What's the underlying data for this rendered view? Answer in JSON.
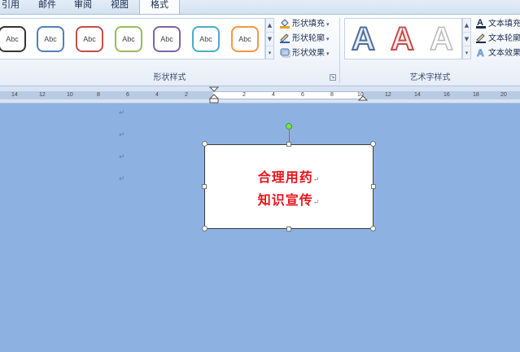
{
  "tabs": [
    {
      "label": "引用",
      "active": false
    },
    {
      "label": "邮件",
      "active": false
    },
    {
      "label": "审阅",
      "active": false
    },
    {
      "label": "视图",
      "active": false
    },
    {
      "label": "格式",
      "active": true
    }
  ],
  "shape_styles": {
    "group_label": "形状样式",
    "swatches": [
      {
        "label": "Abc",
        "color": "#333333"
      },
      {
        "label": "Abc",
        "color": "#4f81bd"
      },
      {
        "label": "Abc",
        "color": "#c0504d"
      },
      {
        "label": "Abc",
        "color": "#9bbb59"
      },
      {
        "label": "Abc",
        "color": "#8064a2"
      },
      {
        "label": "Abc",
        "color": "#4bacc6"
      },
      {
        "label": "Abc",
        "color": "#f79646"
      }
    ],
    "commands": {
      "fill": "形状填充",
      "outline": "形状轮廓",
      "effects": "形状效果"
    }
  },
  "wordart_styles": {
    "group_label": "艺术字样式",
    "letters": [
      {
        "label": "A",
        "style": "blue-outline"
      },
      {
        "label": "A",
        "style": "red-outline"
      },
      {
        "label": "A",
        "style": "gray-outline"
      }
    ],
    "commands": {
      "text_fill": "文本填充",
      "text_outline": "文本轮廓",
      "text_effects": "文本效果"
    }
  },
  "ruler": {
    "left_numbers": [
      "14",
      "12",
      "10",
      "8",
      "6",
      "4",
      "2"
    ],
    "right_numbers": [
      "2",
      "4",
      "6",
      "8",
      "10",
      "12",
      "14",
      "16",
      "18",
      "20"
    ]
  },
  "document": {
    "paragraph_mark": "↵",
    "textbox": {
      "line1": "合理用药",
      "line2": "知识宣传"
    }
  }
}
